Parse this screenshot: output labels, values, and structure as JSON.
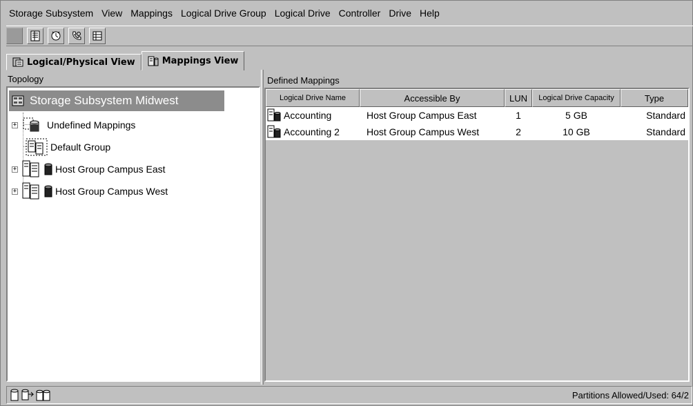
{
  "menu": [
    "Storage Subsystem",
    "View",
    "Mappings",
    "Logical Drive Group",
    "Logical Drive",
    "Controller",
    "Drive",
    "Help"
  ],
  "toolbar": {
    "buttons": [
      "stop-icon",
      "properties-icon",
      "clock-icon",
      "phone-icon",
      "storage-layout-icon"
    ]
  },
  "tabs": {
    "logical_physical": "Logical/Physical View",
    "mappings": "Mappings View"
  },
  "topology": {
    "header": "Topology",
    "root": "Storage Subsystem Midwest",
    "items": [
      {
        "label": "Undefined Mappings"
      },
      {
        "label": "Default Group"
      },
      {
        "label": "Host Group Campus East"
      },
      {
        "label": "Host Group Campus West"
      }
    ]
  },
  "mappings": {
    "header": "Defined Mappings",
    "columns": [
      "Logical Drive Name",
      "Accessible By",
      "LUN",
      "Logical Drive Capacity",
      "Type"
    ],
    "rows": [
      {
        "name": "Accounting",
        "accessible_by": "Host Group Campus East",
        "lun": "1",
        "capacity": "5 GB",
        "type": "Standard"
      },
      {
        "name": "Accounting 2",
        "accessible_by": "Host Group Campus West",
        "lun": "2",
        "capacity": "10 GB",
        "type": "Standard"
      }
    ]
  },
  "status": {
    "text": "Partitions Allowed/Used: 64/2"
  }
}
